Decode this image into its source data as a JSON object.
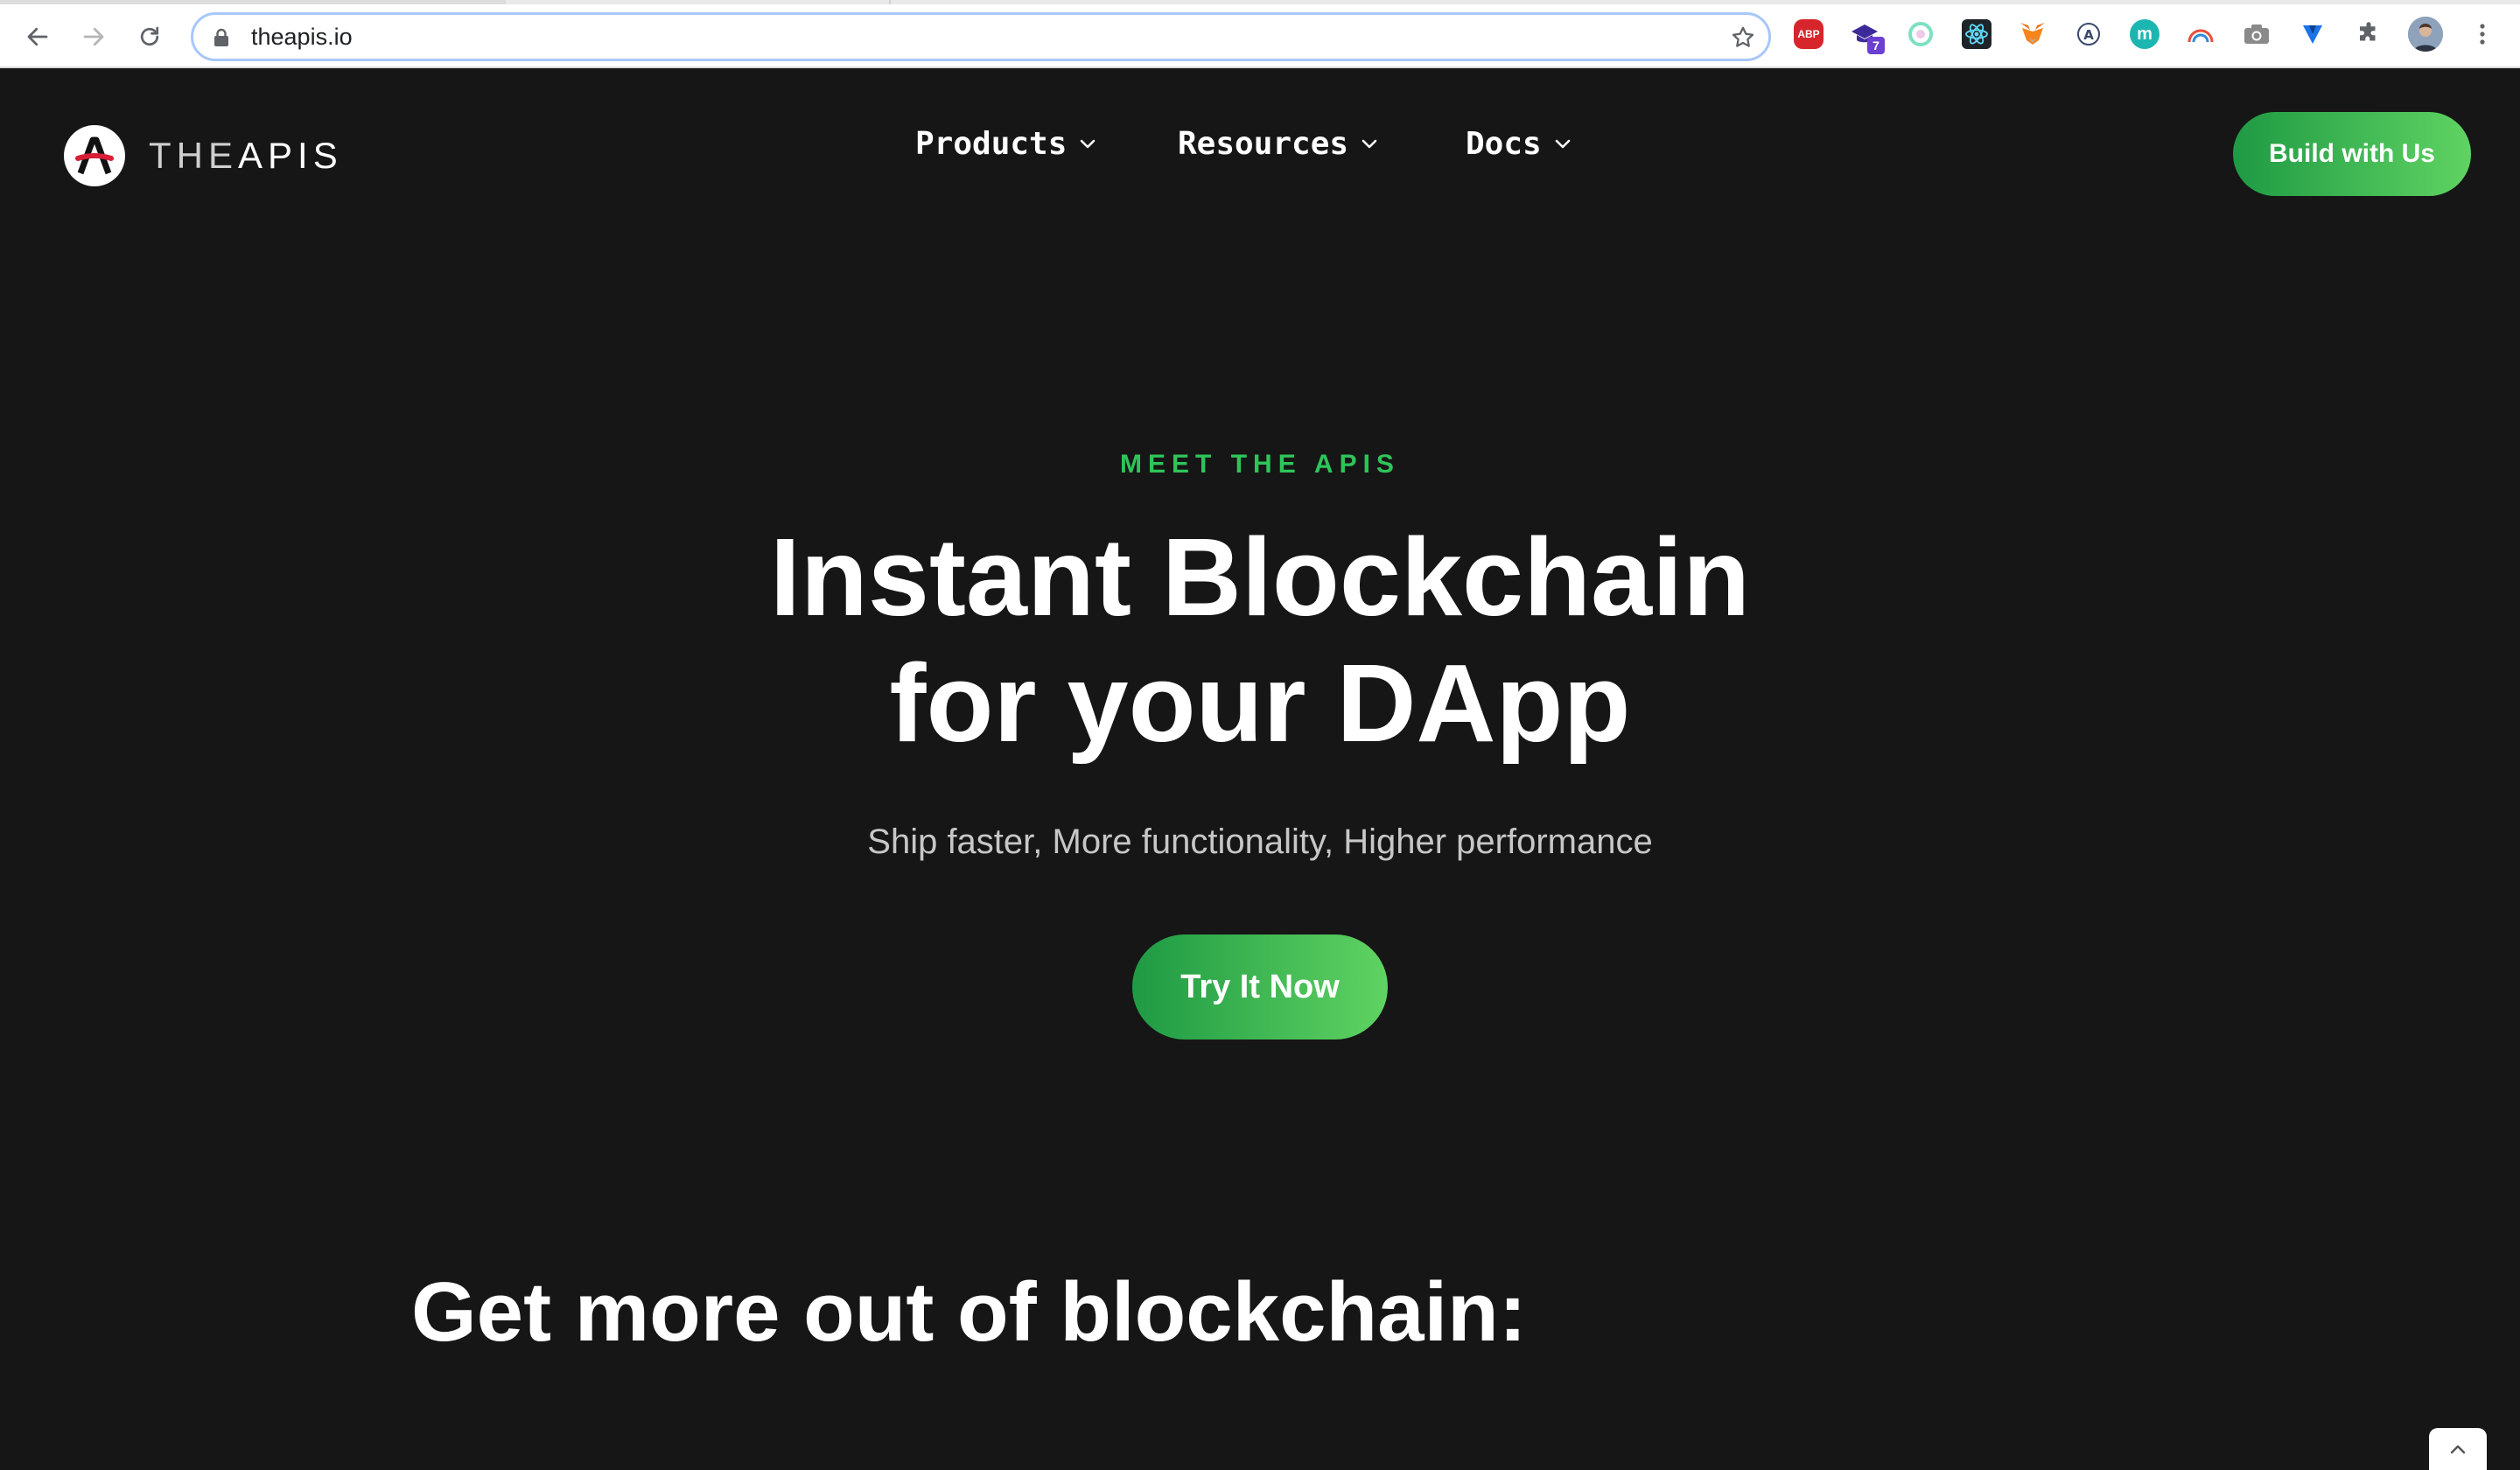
{
  "browser": {
    "url": "theapis.io",
    "extension_badge": "7"
  },
  "site": {
    "logo_prefix": "THE",
    "logo_suffix": "APIS",
    "nav": [
      {
        "label": "Products"
      },
      {
        "label": "Resources"
      },
      {
        "label": "Docs"
      }
    ],
    "cta_top": "Build with Us"
  },
  "hero": {
    "eyebrow": "MEET THE APIS",
    "headline_line1": "Instant Blockchain",
    "headline_line2": "for your DApp",
    "subtitle": "Ship faster, More functionality, Higher performance",
    "cta": "Try It Now"
  },
  "section": {
    "title": "Get more out of blockchain:"
  },
  "colors": {
    "accent_green": "#2fc45a",
    "page_bg": "#161616"
  }
}
